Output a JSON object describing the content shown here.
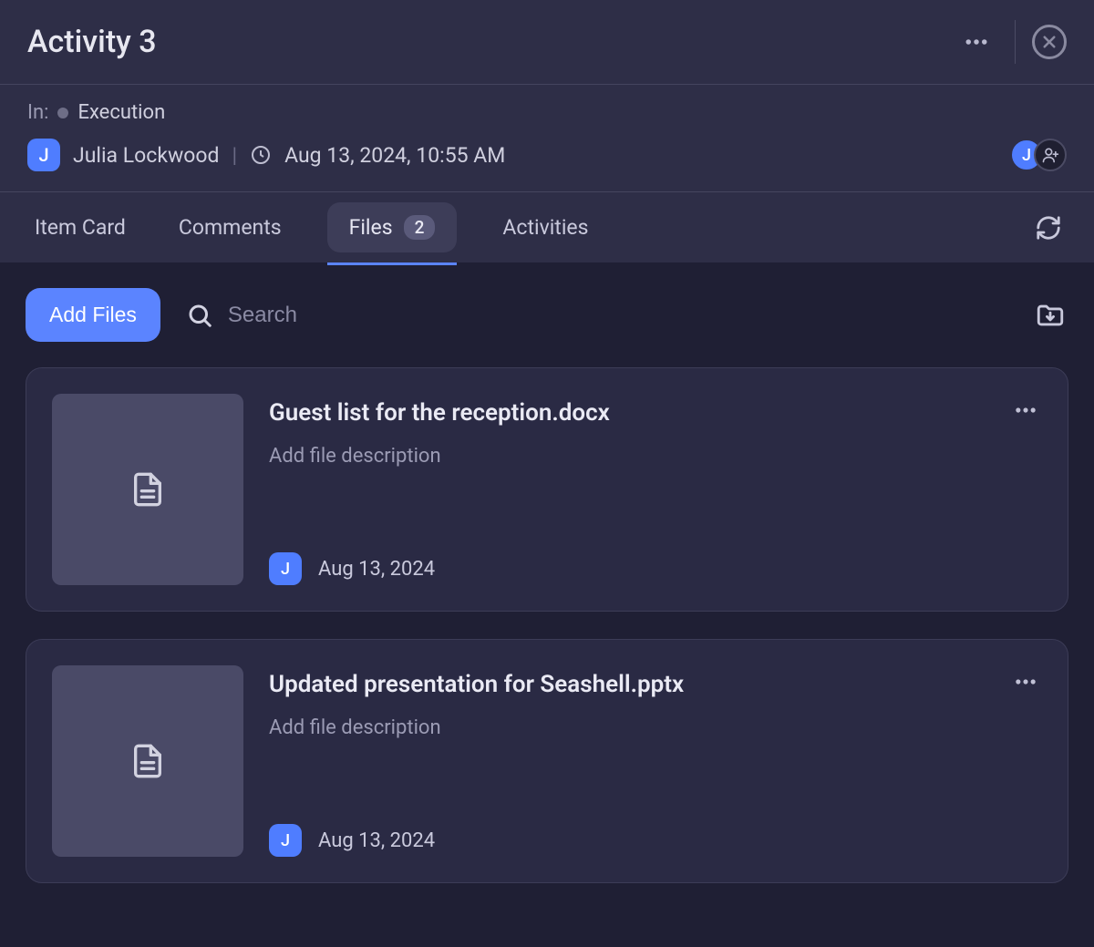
{
  "header": {
    "title": "Activity 3"
  },
  "meta": {
    "in_label": "In:",
    "status": "Execution",
    "author_initial": "J",
    "author_name": "Julia Lockwood",
    "timestamp": "Aug 13, 2024, 10:55 AM",
    "assignees": [
      {
        "initial": "J"
      }
    ]
  },
  "tabs": [
    {
      "label": "Item Card"
    },
    {
      "label": "Comments"
    },
    {
      "label": "Files",
      "badge": "2",
      "active": true
    },
    {
      "label": "Activities"
    }
  ],
  "toolbar": {
    "add_files": "Add Files",
    "search_placeholder": "Search"
  },
  "files": [
    {
      "name": "Guest list for the reception.docx",
      "description_placeholder": "Add file description",
      "uploader_initial": "J",
      "date": "Aug 13, 2024"
    },
    {
      "name": "Updated presentation for Seashell.pptx",
      "description_placeholder": "Add file description",
      "uploader_initial": "J",
      "date": "Aug 13, 2024"
    }
  ]
}
